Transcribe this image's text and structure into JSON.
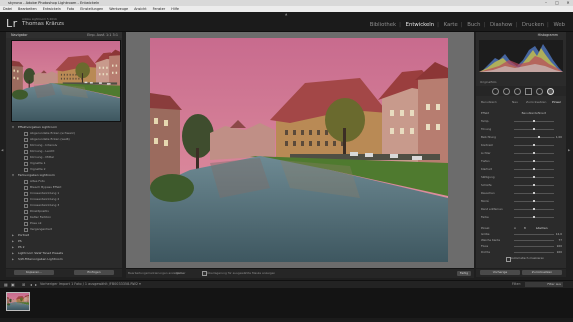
{
  "window": {
    "title": "skyrona - Adobe Photoshop Lightroom - Entwickeln",
    "controls": [
      "–",
      "□",
      "✕"
    ]
  },
  "menu": [
    "Datei",
    "Bearbeiten",
    "Entwickeln",
    "Foto",
    "Einstellungen",
    "Werkzeuge",
    "Ansicht",
    "Fenster",
    "Hilfe"
  ],
  "identity": {
    "logo": "Lr",
    "catalog": "Adobe Lightroom 5 2014",
    "user": "Thomas Kränzs"
  },
  "modules": [
    {
      "label": "Bibliothek",
      "active": false
    },
    {
      "label": "Entwickeln",
      "active": true
    },
    {
      "label": "Karte",
      "active": false
    },
    {
      "label": "Buch",
      "active": false
    },
    {
      "label": "Diashow",
      "active": false
    },
    {
      "label": "Drucken",
      "active": false
    },
    {
      "label": "Web",
      "active": false
    }
  ],
  "navigator": {
    "title": "Navigator",
    "zoom_options": "Einp.  Ausf.  1:1  3:1"
  },
  "presets": [
    {
      "type": "folder",
      "label": "Effektvorgaben Lightroom",
      "open": true
    },
    {
      "type": "item",
      "label": "Abgerundete Ecken (schwarz)"
    },
    {
      "type": "item",
      "label": "Abgerundete Ecken (weiß)"
    },
    {
      "type": "item",
      "label": "Körnung - Intensiv"
    },
    {
      "type": "item",
      "label": "Körnung - Leicht"
    },
    {
      "type": "item",
      "label": "Körnung - Mittel"
    },
    {
      "type": "item",
      "label": "Vignette 1"
    },
    {
      "type": "item",
      "label": "Vignette 2"
    },
    {
      "type": "folder",
      "label": "Farbvorgaben Lightroom",
      "open": true
    },
    {
      "type": "item",
      "label": "Altes Foto"
    },
    {
      "type": "item",
      "label": "Bleach Bypass Effekt"
    },
    {
      "type": "item",
      "label": "Crossentwicklung 1"
    },
    {
      "type": "item",
      "label": "Crossentwicklung 2"
    },
    {
      "type": "item",
      "label": "Crossentwicklung 3"
    },
    {
      "type": "item",
      "label": "Direktpositiv"
    },
    {
      "type": "item",
      "label": "Kalter Farbton"
    },
    {
      "type": "item",
      "label": "Pose ok"
    },
    {
      "type": "item",
      "label": "Vergangenheit"
    },
    {
      "type": "folder",
      "label": "Portrait",
      "open": false
    },
    {
      "type": "folder",
      "label": "PS",
      "open": false
    },
    {
      "type": "folder",
      "label": "PS 2",
      "open": false
    },
    {
      "type": "folder",
      "label": "Lightroom S&W Toned Presets",
      "open": false
    },
    {
      "type": "folder",
      "label": "S/W-Filtervorgaben Lightroom",
      "open": false
    }
  ],
  "left_buttons": [
    "Kopieren...",
    "Einfügen"
  ],
  "toolbar": {
    "message": "Bearbeitungsmarkierungen anzeigen:",
    "mode": "Immer",
    "checkbox_label": "Überlagerung für ausgewählte Maske anzeigen",
    "done": "Fertig"
  },
  "histogram": {
    "title": "Histogramm",
    "original_label": "Originalfoto"
  },
  "profiles": [
    "Benutzerd.",
    "Neu",
    "Zurücksetzen",
    "Pinsel"
  ],
  "adjustments": {
    "effect_label": "Effekt",
    "effect_value": "Benutzerdefiniert",
    "sliders": [
      {
        "name": "Temp.",
        "pos": 0.5,
        "value": ""
      },
      {
        "name": "Tönung",
        "pos": 0.5,
        "value": ""
      },
      {
        "name": "Belichtung",
        "pos": 0.63,
        "value": "– 1,00"
      },
      {
        "name": "Kontrast",
        "pos": 0.5,
        "value": ""
      },
      {
        "name": "Lichter",
        "pos": 0.5,
        "value": ""
      },
      {
        "name": "Tiefen",
        "pos": 0.5,
        "value": ""
      },
      {
        "name": "Klarheit",
        "pos": 0.5,
        "value": ""
      },
      {
        "name": "Sättigung",
        "pos": 0.5,
        "value": ""
      },
      {
        "name": "Schärfe",
        "pos": 0.5,
        "value": ""
      },
      {
        "name": "Rauschen",
        "pos": 0.5,
        "value": ""
      },
      {
        "name": "Moiré",
        "pos": 0.5,
        "value": ""
      },
      {
        "name": "Rand entfernen",
        "pos": 0.5,
        "value": ""
      },
      {
        "name": "Farbe",
        "pos": 0.5,
        "value": ""
      }
    ],
    "brush_label": "Pinsel:",
    "brush_tabs": [
      "A",
      "B",
      "Löschen"
    ],
    "brush_sliders": [
      {
        "name": "Größe",
        "value": "12,0"
      },
      {
        "name": "Weiche Kante",
        "value": "77"
      },
      {
        "name": "Fluss",
        "value": "100"
      },
      {
        "name": "Dichte",
        "value": "100"
      }
    ],
    "auto_mask_label": "Automatisch maskieren"
  },
  "right_buttons": [
    "Vorherige",
    "Zurücksetzen"
  ],
  "filmstrip": {
    "info": "Vorheriger Import   1 Foto / 1 ausgewählt  /FB0033358.RW2 ▾",
    "filter_label": "Filter:",
    "filter_value": "Filter aus"
  },
  "colors": {
    "accent": "#e8e8e8",
    "panel": "#2b2b2b",
    "background": "#1f1f1f"
  }
}
